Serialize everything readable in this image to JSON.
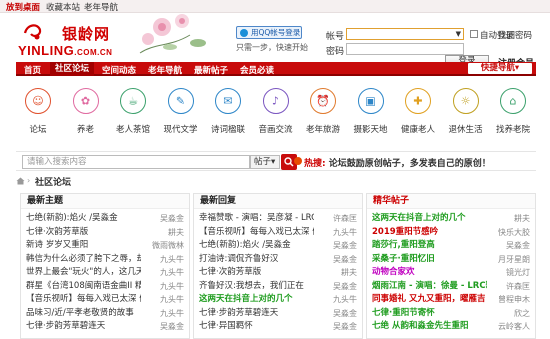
{
  "topbar": {
    "home": "放到桌面",
    "favorite": "收藏本站",
    "nav": "老年导航"
  },
  "logo": {
    "cn": "银龄网",
    "en": "YINLING",
    "en_suffix": ".COM.CN"
  },
  "qq": {
    "button": "用QQ帐号登录",
    "tip": "只需一步，快速开始"
  },
  "login": {
    "user_label": "帐号",
    "pass_label": "密码",
    "auto_login": "自动登录",
    "find_password": "找回密码",
    "submit": "登录",
    "register": "注册会员"
  },
  "nav": {
    "items": [
      "首页",
      "社区论坛",
      "空间动态",
      "老年导航",
      "最新帖子",
      "会员必读"
    ],
    "quick": "快捷导航▾"
  },
  "icons": [
    {
      "label": "论坛",
      "name": "forum-icon",
      "glyph": "☺",
      "color": "#e0502d"
    },
    {
      "label": "养老",
      "name": "elder-care-icon",
      "glyph": "✿",
      "color": "#e06aa0"
    },
    {
      "label": "老人茶馆",
      "name": "tea-house-icon",
      "glyph": "☕",
      "color": "#3aa06b"
    },
    {
      "label": "现代文学",
      "name": "literature-icon",
      "glyph": "✎",
      "color": "#2d86c8"
    },
    {
      "label": "诗词楹联",
      "name": "poetry-icon",
      "glyph": "✉",
      "color": "#2d86c8"
    },
    {
      "label": "音画交流",
      "name": "music-icon",
      "glyph": "♪",
      "color": "#7a55c0"
    },
    {
      "label": "老年旅游",
      "name": "travel-icon",
      "glyph": "⏰",
      "color": "#e07a2d"
    },
    {
      "label": "摄影天地",
      "name": "photography-icon",
      "glyph": "▣",
      "color": "#2d86c8"
    },
    {
      "label": "健康老人",
      "name": "health-icon",
      "glyph": "✚",
      "color": "#e0a020"
    },
    {
      "label": "退休生活",
      "name": "retirement-icon",
      "glyph": "☼",
      "color": "#c0a020"
    },
    {
      "label": "找养老院",
      "name": "nursing-home-icon",
      "glyph": "⌂",
      "color": "#3aa06b"
    }
  ],
  "search": {
    "placeholder": "请输入搜索内容",
    "scope": "帖子▾",
    "hot_label": "热搜:",
    "hot_text": "论坛鼓励原创帖子，多发表自己的原创！"
  },
  "breadcrumb": {
    "sep": "›",
    "current": "社区论坛"
  },
  "columns": {
    "latest_topics": {
      "title": "最新主题",
      "items": [
        {
          "t": "七绝(新韵):焰火 /吴淼金",
          "a": "吴淼金"
        },
        {
          "t": "七律·次韵芳草版",
          "a": "耕夫"
        },
        {
          "t": "新诗 岁岁又重阳",
          "a": "微雨微林"
        },
        {
          "t": "韩信为什么必须了胯下之辱，却",
          "a": "九头牛"
        },
        {
          "t": "世界上最会\"玩火\"的人，这几天",
          "a": "九头牛"
        },
        {
          "t": "群星《台湾108闽南语金曲II 精装",
          "a": "九头牛"
        },
        {
          "t": "【音乐视听】每每入戏已太深 假",
          "a": "九头牛"
        },
        {
          "t": "品味习/近/平孝老敬贤的故事",
          "a": "九头牛"
        },
        {
          "t": "七律·步韵芳草碧连天",
          "a": "吴淼金"
        }
      ]
    },
    "latest_replies": {
      "title": "最新回复",
      "items": [
        {
          "t": "幸福赞歌 - 演唱：吴彦凝 - LRC歌",
          "a": "许森匡",
          "c": ""
        },
        {
          "t": "【音乐视听】每每入戏已太深 假",
          "a": "九头牛",
          "c": ""
        },
        {
          "t": "七绝(新韵):焰火 /吴淼金",
          "a": "吴淼金",
          "c": ""
        },
        {
          "t": "打油诗:调侃齐鲁好汉",
          "a": "吴淼金",
          "c": ""
        },
        {
          "t": "七律·次韵芳草版",
          "a": "耕夫",
          "c": ""
        },
        {
          "t": "齐鲁好汉:我想去，我们正在",
          "a": "吴淼金",
          "c": ""
        },
        {
          "t": "这两天在抖音上对的几个",
          "a": "九头牛",
          "c": "green"
        },
        {
          "t": "七律·步韵芳草碧连天",
          "a": "吴淼金",
          "c": ""
        },
        {
          "t": "七律·异国羁怀",
          "a": "吴淼金",
          "c": ""
        }
      ]
    },
    "featured": {
      "title": "精华帖子",
      "items": [
        {
          "t": "这两天在抖音上对的几个",
          "a": "耕夫",
          "c": "green"
        },
        {
          "t": "2019重阳节感吟",
          "a": "快乐大胶",
          "c": "red"
        },
        {
          "t": "踏莎行,重阳登高",
          "a": "吴淼金",
          "c": "green"
        },
        {
          "t": "采桑子·重阳忆旧",
          "a": "月牙星朗",
          "c": "green"
        },
        {
          "t": "动物合家欢",
          "a": "镜光灯",
          "c": "magenta"
        },
        {
          "t": "烟雨江南 - 演唱：徐曼 - LRC歌",
          "a": "许森匡",
          "c": "green"
        },
        {
          "t": "同事婚礼 又九又重阳，曜雁吉",
          "a": "曾程申木",
          "c": "red"
        },
        {
          "t": "七律·重阳节寄怀",
          "a": "欣之",
          "c": "green"
        },
        {
          "t": "七绝 从韵和淼金先生重阳",
          "a": "云岭客人",
          "c": "green"
        }
      ]
    }
  }
}
